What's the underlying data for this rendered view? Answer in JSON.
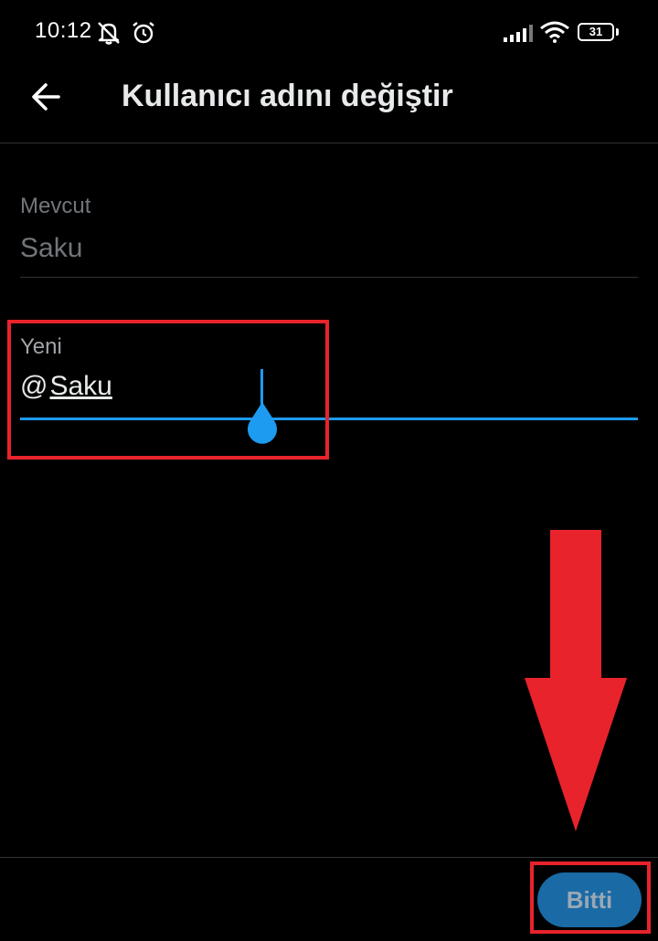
{
  "status_bar": {
    "time": "10:12",
    "icons": [
      "muted-bell-icon",
      "alarm-icon",
      "cell-signal-icon",
      "wifi-icon",
      "battery-icon"
    ],
    "battery_level": "31"
  },
  "header": {
    "back_icon": "arrow-left-icon",
    "title": "Kullanıcı adını değiştir"
  },
  "current": {
    "label": "Mevcut",
    "value": "Saku"
  },
  "new": {
    "label": "Yeni",
    "prefix": "@",
    "value": "Saku"
  },
  "footer": {
    "done_label": "Bitti"
  },
  "colors": {
    "background": "#000000",
    "accent": "#1d9bf0",
    "button": "#1a6aa6",
    "annotation": "#e8232b"
  }
}
